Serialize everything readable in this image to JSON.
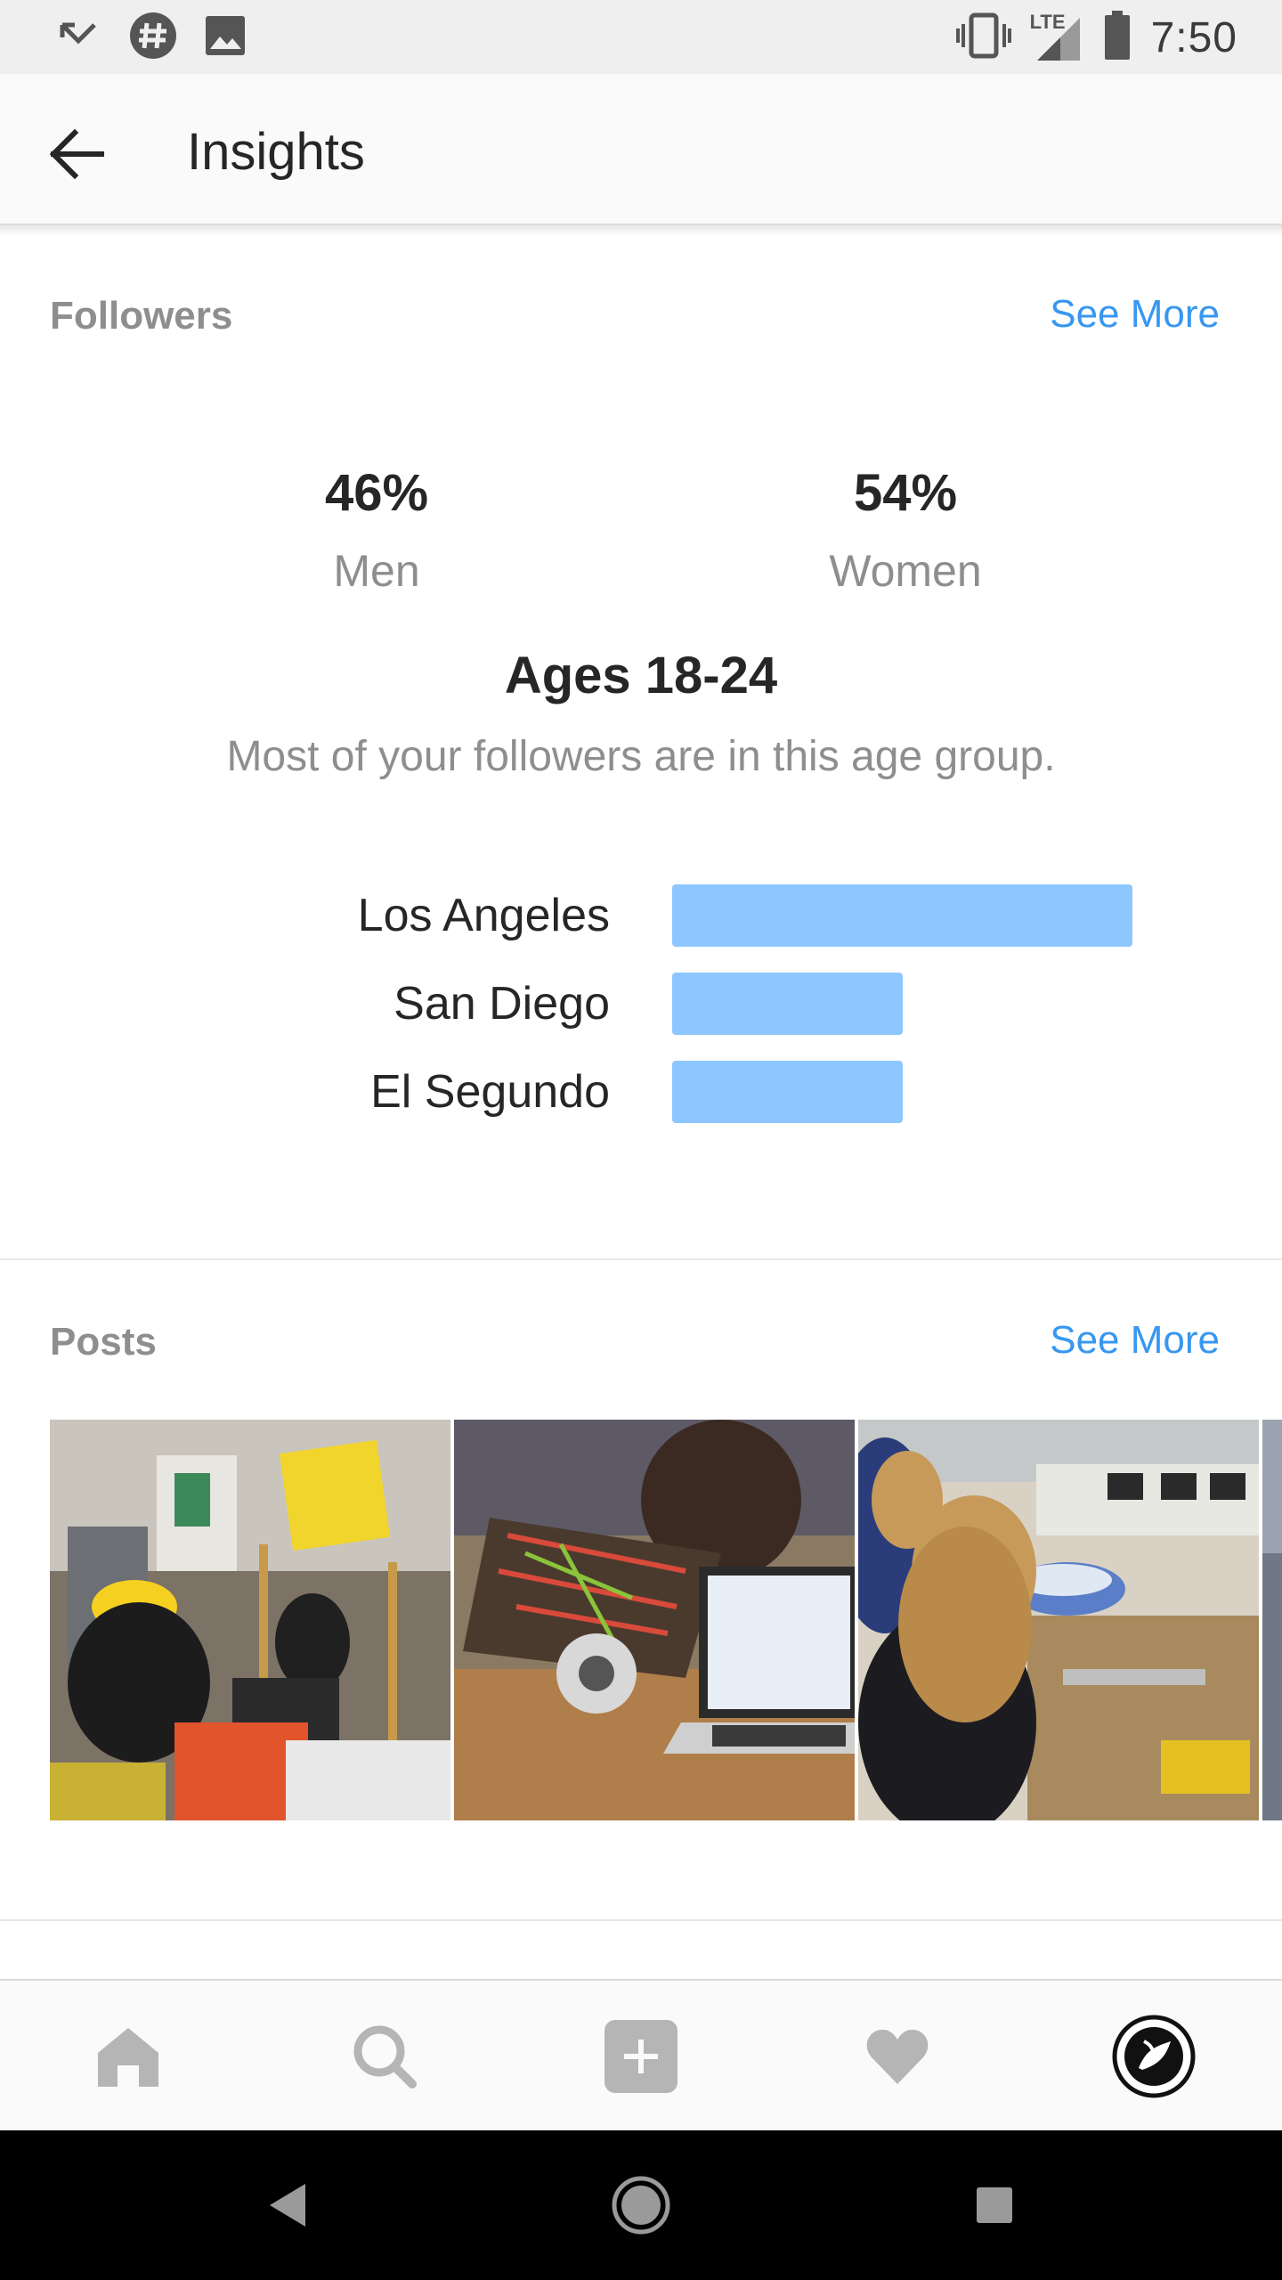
{
  "status_bar": {
    "time": "7:50",
    "network": "LTE",
    "icons": [
      "missed-call-icon",
      "hashtag-app-icon",
      "image-icon",
      "vibrate-icon",
      "signal-icon",
      "battery-icon"
    ]
  },
  "app_bar": {
    "title": "Insights",
    "back_icon": "back-arrow-icon"
  },
  "followers": {
    "header": "Followers",
    "see_more": "See More",
    "gender": [
      {
        "value": "46%",
        "label": "Men"
      },
      {
        "value": "54%",
        "label": "Women"
      }
    ],
    "age_title": "Ages 18-24",
    "age_subtitle": "Most of your followers are in this age group.",
    "locations": [
      {
        "label": "Los Angeles",
        "share": 1.0
      },
      {
        "label": "San Diego",
        "share": 0.5
      },
      {
        "label": "El Segundo",
        "share": 0.5
      }
    ],
    "bar_color": "#8ec7ff"
  },
  "posts": {
    "header": "Posts",
    "see_more": "See More",
    "photos": [
      "robotics-workshop-photo",
      "robot-and-laptop-photo",
      "students-building-photo",
      "partial-photo"
    ]
  },
  "bottom_nav": {
    "items": [
      "home-icon",
      "search-icon",
      "add-post-icon",
      "activity-heart-icon",
      "profile-avatar-icon"
    ]
  },
  "system_nav": {
    "items": [
      "back-triangle-icon",
      "home-circle-icon",
      "recents-square-icon"
    ]
  },
  "colors": {
    "accent": "#3897f0",
    "muted_text": "#8e8e8e",
    "primary_text": "#262626"
  }
}
